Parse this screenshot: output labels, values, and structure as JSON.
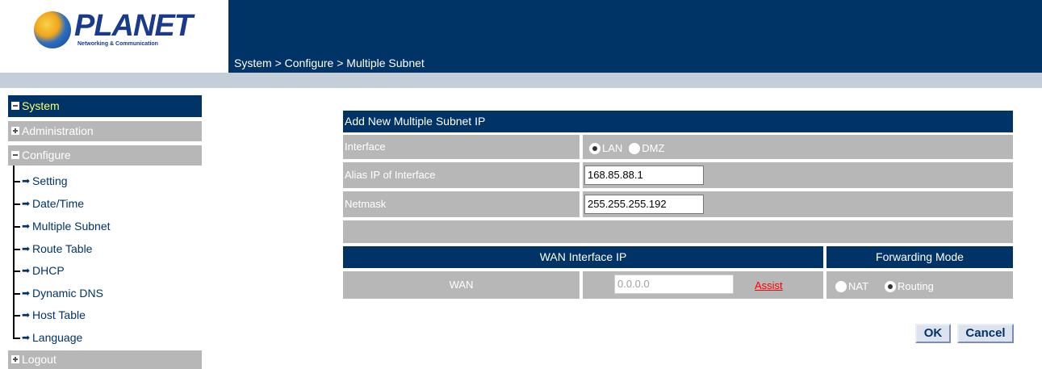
{
  "brand": {
    "name": "PLANET",
    "tagline": "Networking & Communication"
  },
  "breadcrumb": "System > Configure > Multiple Subnet",
  "sidebar": {
    "system": "System",
    "administration": "Administration",
    "configure": "Configure",
    "items": [
      "Setting",
      "Date/Time",
      "Multiple Subnet",
      "Route Table",
      "DHCP",
      "Dynamic DNS",
      "Host Table",
      "Language"
    ],
    "logout": "Logout"
  },
  "form": {
    "title": "Add New Multiple Subnet IP",
    "interface_label": "Interface",
    "interface_options": [
      "LAN",
      "DMZ"
    ],
    "interface_selected": "LAN",
    "alias_label": "Alias IP of Interface",
    "alias_value": "168.85.88.1",
    "netmask_label": "Netmask",
    "netmask_value": "255.255.255.192",
    "wan_header": "WAN Interface IP",
    "forwarding_header": "Forwarding Mode",
    "wan_label": "WAN",
    "wan_ip_placeholder": "0.0.0.0",
    "assist": "Assist",
    "mode_options": [
      "NAT",
      "Routing"
    ],
    "mode_selected": "Routing"
  },
  "buttons": {
    "ok": "OK",
    "cancel": "Cancel"
  },
  "colors": {
    "navy": "#003366",
    "gray": "#b7b7b7",
    "highlight": "#ffff66",
    "link_red": "#ff0000"
  }
}
